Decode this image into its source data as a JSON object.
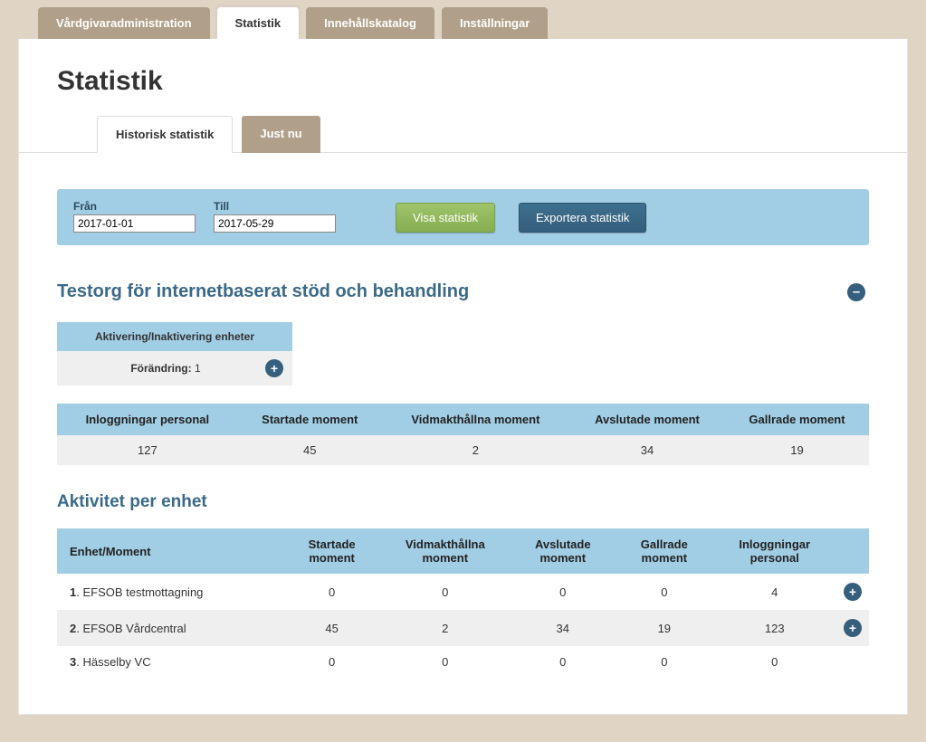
{
  "top_tabs": {
    "vardgivar": "Vårdgivaradministration",
    "statistik": "Statistik",
    "innehall": "Innehållskatalog",
    "installningar": "Inställningar"
  },
  "page_title": "Statistik",
  "sub_tabs": {
    "historisk": "Historisk statistik",
    "justnu": "Just nu"
  },
  "filter": {
    "from_label": "Från",
    "to_label": "Till",
    "from_value": "2017-01-01",
    "to_value": "2017-05-29",
    "show_btn": "Visa statistik",
    "export_btn": "Exportera statistik"
  },
  "org_title": "Testorg för internetbaserat stöd och behandling",
  "activation": {
    "header": "Aktivering/Inaktivering enheter",
    "label": "Förändring:",
    "value": "1"
  },
  "summary": {
    "headers": {
      "logins": "Inloggningar personal",
      "started": "Startade moment",
      "maintained": "Vidmakthållna moment",
      "finished": "Avslutade moment",
      "culled": "Gallrade moment"
    },
    "values": {
      "logins": "127",
      "started": "45",
      "maintained": "2",
      "finished": "34",
      "culled": "19"
    }
  },
  "activity_title": "Aktivitet per enhet",
  "unit_headers": {
    "unit": "Enhet/Moment",
    "started": "Startade moment",
    "maintained": "Vidmakthållna moment",
    "finished": "Avslutade moment",
    "culled": "Gallrade moment",
    "logins": "Inloggningar personal"
  },
  "units": [
    {
      "idx": "1",
      "name": "EFSOB testmottagning",
      "started": "0",
      "maintained": "0",
      "finished": "0",
      "culled": "0",
      "logins": "4",
      "expand": true
    },
    {
      "idx": "2",
      "name": "EFSOB Vårdcentral",
      "started": "45",
      "maintained": "2",
      "finished": "34",
      "culled": "19",
      "logins": "123",
      "expand": true
    },
    {
      "idx": "3",
      "name": "Hässelby VC",
      "started": "0",
      "maintained": "0",
      "finished": "0",
      "culled": "0",
      "logins": "0",
      "expand": false
    }
  ]
}
